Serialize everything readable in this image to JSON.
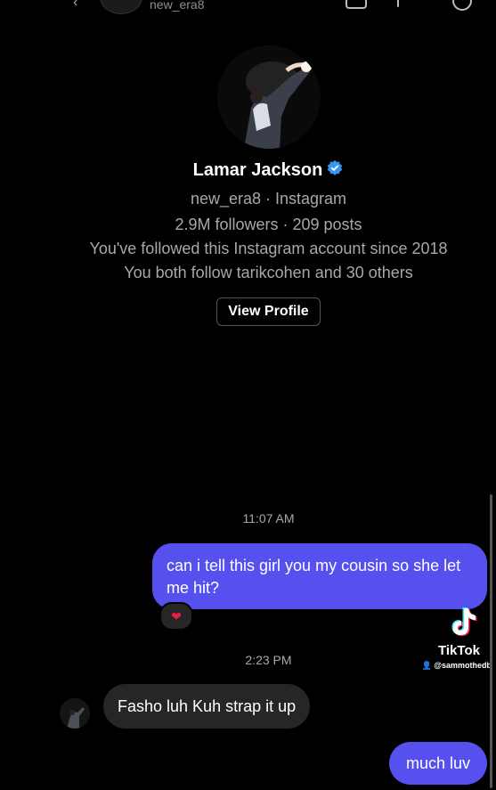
{
  "header": {
    "username": "new_era8"
  },
  "profile": {
    "name": "Lamar Jackson",
    "handle_line": "new_era8 · Instagram",
    "stats_line": "2.9M followers · 209 posts",
    "follow_since": "You've followed this Instagram account since 2018",
    "mutuals": "You both follow tarikcohen and 30 others",
    "view_profile_label": "View Profile"
  },
  "messages": {
    "time_1": "11:07 AM",
    "outgoing_1": "can i tell this girl you my cousin so she let me hit?",
    "reaction": "❤",
    "time_2": "2:23 PM",
    "incoming_1": "Fasho luh Kuh strap it up",
    "outgoing_2": "much luv"
  },
  "watermark": {
    "brand": "TikTok",
    "handle": "@sammothedb"
  },
  "colors": {
    "background": "#000000",
    "outgoing_bubble": "#5650ee",
    "incoming_bubble": "#262626",
    "verified_badge": "#3797f0",
    "secondary_text": "#a8a8a8"
  }
}
